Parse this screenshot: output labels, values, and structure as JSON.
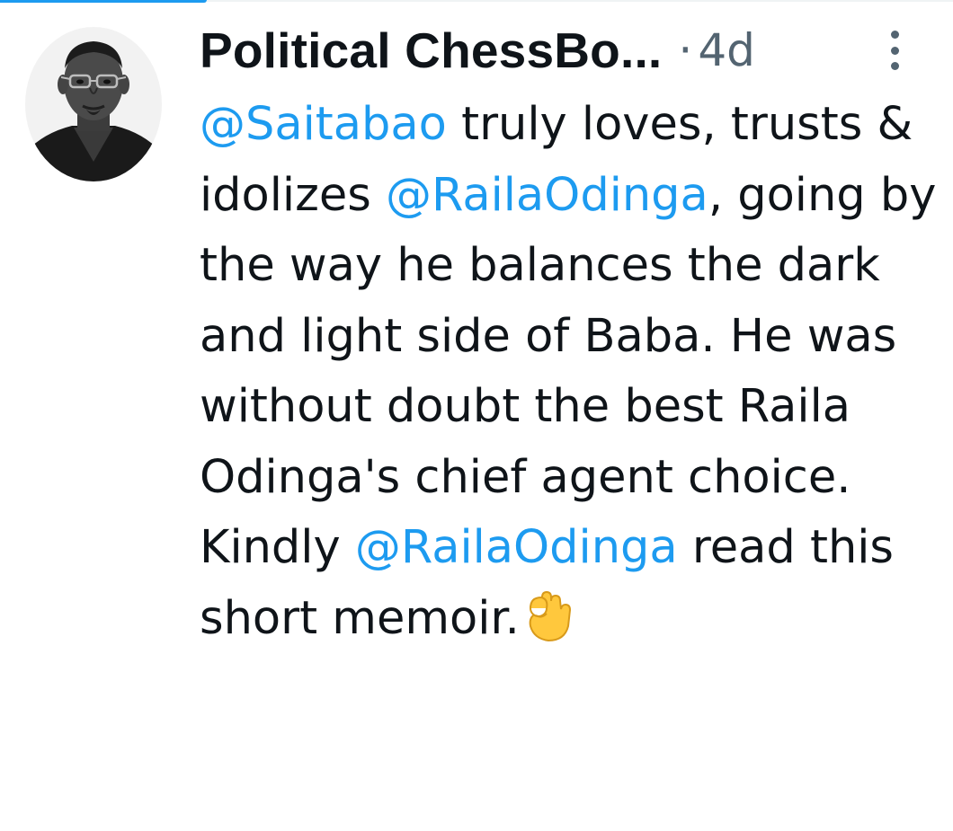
{
  "tweet": {
    "author_name": "Political ChessBo...",
    "separator": "·",
    "timestamp": "4d",
    "more_icon": "more-vertical-icon",
    "avatar": "avatar-photo",
    "text": {
      "mention_1": "@Saitabao",
      "seg_1": " truly loves, trusts & idolizes ",
      "mention_2": "@RailaOdinga",
      "seg_2": ", going by the way he balances the dark and light side of Baba. He was without doubt the best Raila Odinga's chief agent choice. Kindly ",
      "mention_3": "@RailaOdinga",
      "seg_3": " read this short memoir.",
      "emoji": "ok-hand-emoji"
    }
  },
  "colors": {
    "link": "#1d9bf0",
    "text": "#0f1419",
    "secondary": "#536471",
    "background": "#ffffff"
  }
}
